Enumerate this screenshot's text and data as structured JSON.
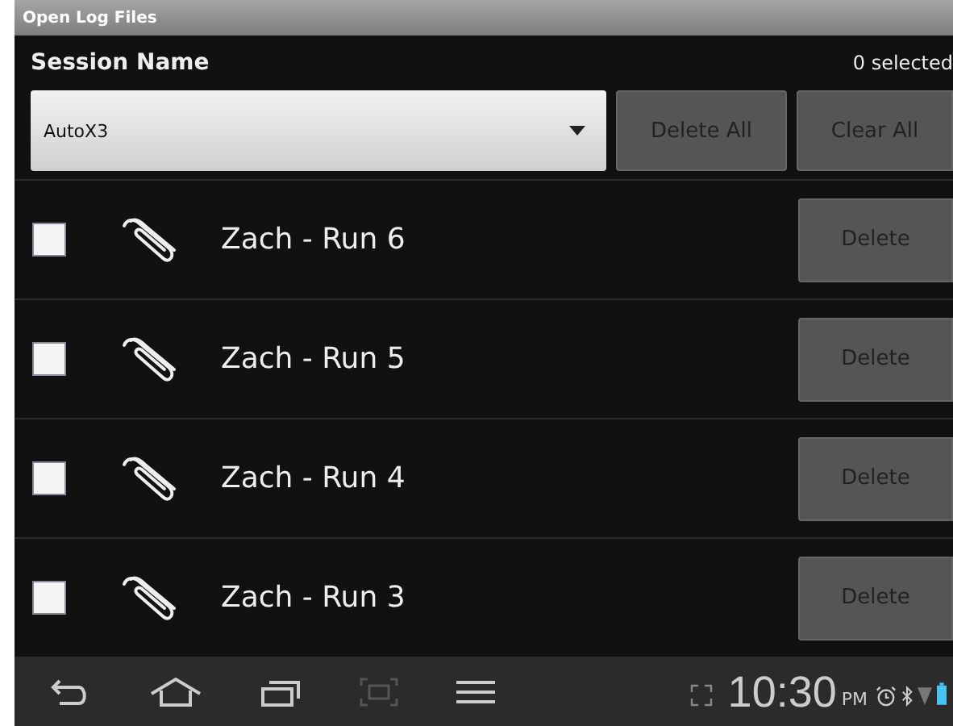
{
  "window": {
    "title": "Open Log Files"
  },
  "header": {
    "label": "Session Name",
    "count": "0 selected"
  },
  "session": {
    "value": "AutoX3"
  },
  "buttons": [
    "Delete All",
    "Clear All"
  ],
  "logs": [
    {
      "name": "Zach - Run 6",
      "checked": false,
      "action": "Delete"
    },
    {
      "name": "Zach - Run 5",
      "checked": false,
      "action": "Delete"
    },
    {
      "name": "Zach - Run 4",
      "checked": false,
      "action": "Delete"
    },
    {
      "name": "Zach - Run 3",
      "checked": false,
      "action": "Delete"
    }
  ],
  "status_bar": {
    "time": "10:30",
    "ampm": "PM"
  }
}
